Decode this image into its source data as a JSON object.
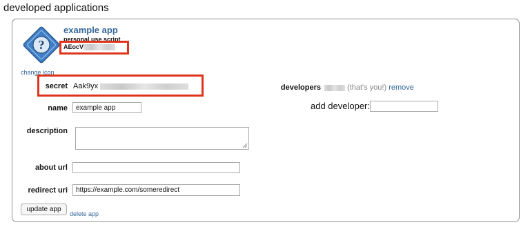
{
  "page": {
    "title": "developed applications"
  },
  "app": {
    "name": "example app",
    "type": "personal use script",
    "client_id": "AEocV",
    "change_icon": "change icon",
    "secret_label": "secret",
    "secret_value": "Aak9yx",
    "name_label": "name",
    "name_value": "example app",
    "description_label": "description",
    "description_value": "",
    "about_url_label": "about url",
    "about_url_value": "",
    "redirect_uri_label": "redirect uri",
    "redirect_uri_value": "https://example.com/someredirect",
    "developers_label": "developers",
    "developer_note": "(that's you!)",
    "remove_link": "remove",
    "add_developer_label": "add developer:",
    "add_developer_value": "",
    "update_button": "update app",
    "delete_link": "delete app"
  },
  "colors": {
    "link": "#336699",
    "highlight_box": "#e0331c",
    "icon_blue": "#3f7fc7"
  },
  "icons": {
    "app_icon": "question-mark-diamond-icon"
  }
}
